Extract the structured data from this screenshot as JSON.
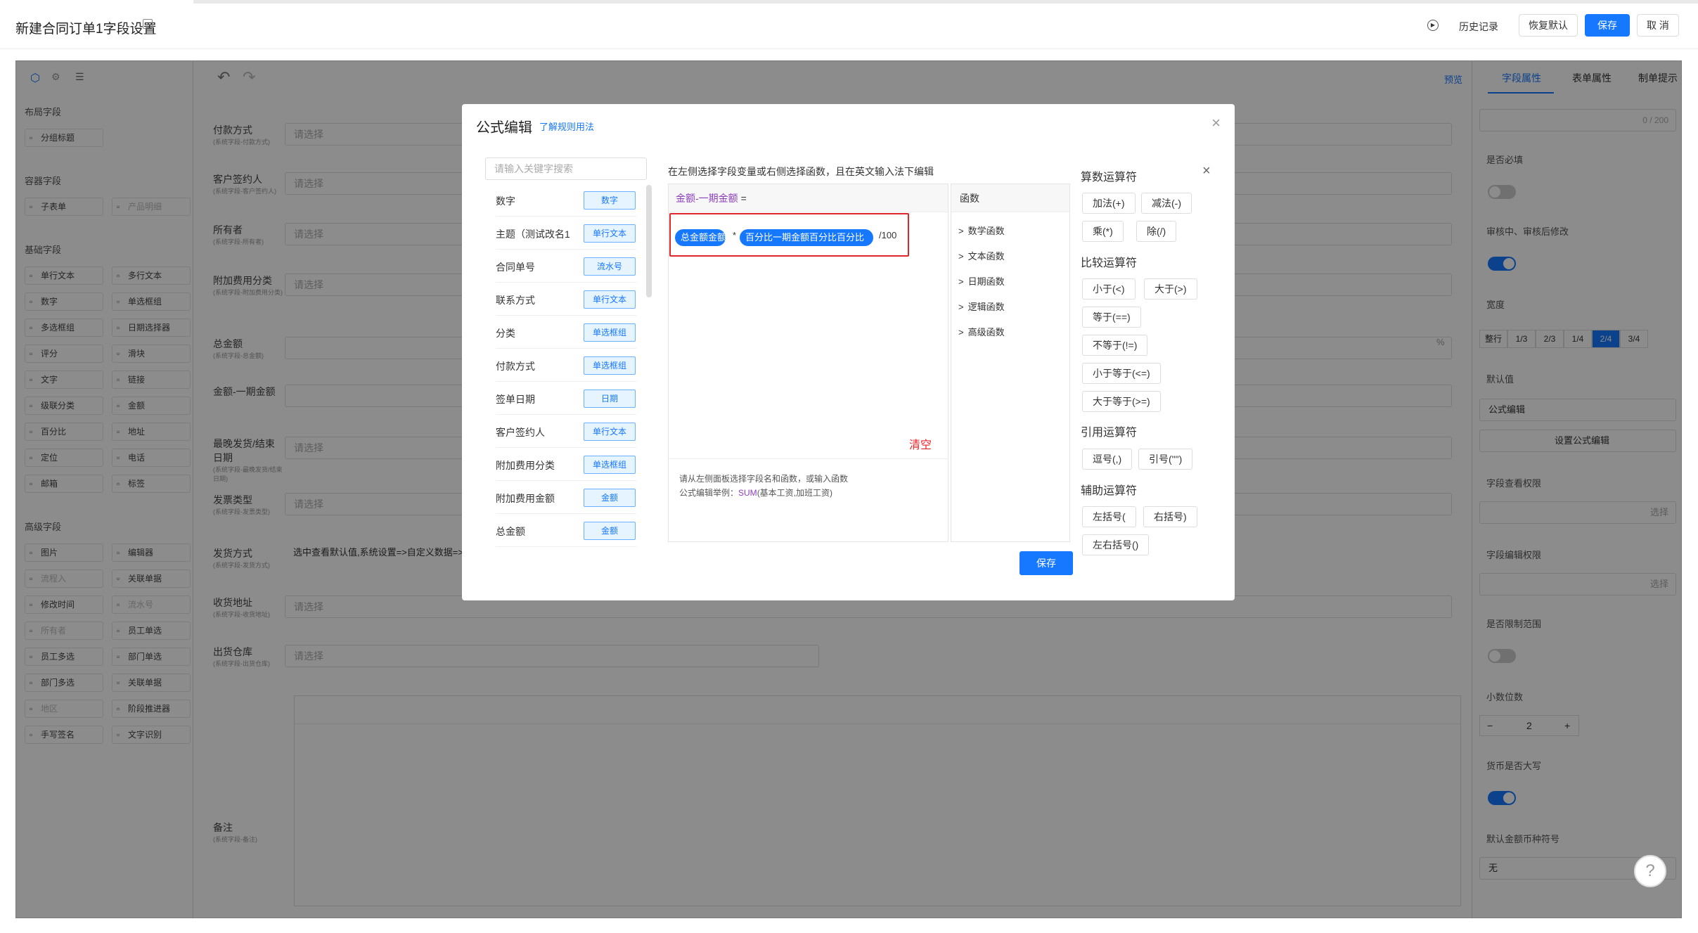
{
  "header": {
    "title": "新建合同订单1字段设置",
    "history": "历史记录",
    "restore": "恢复默认",
    "save": "保存",
    "cancel": "取 消"
  },
  "left_panel": {
    "sections": {
      "layout": "布局字段",
      "container": "容器字段",
      "basic": "基础字段",
      "advanced": "高级字段"
    },
    "layout_items": [
      "分组标题"
    ],
    "container_items": [
      "子表单",
      "产品明细"
    ],
    "basic_items": [
      "单行文本",
      "多行文本",
      "数字",
      "单选框组",
      "多选框组",
      "日期选择器",
      "评分",
      "滑块",
      "文字",
      "链接",
      "级联分类",
      "金额",
      "百分比",
      "地址",
      "定位",
      "电话",
      "邮箱",
      "标签"
    ],
    "advanced_items": [
      "图片",
      "编辑器",
      "流程入",
      "关联单据",
      "修改时间",
      "流水号",
      "所有者",
      "员工单选",
      "员工多选",
      "部门单选",
      "部门多选",
      "关联单据",
      "地区",
      "阶段推进器",
      "手写签名",
      "文字识别"
    ]
  },
  "form": {
    "placeholder": "请选择",
    "fields": [
      {
        "label": "付款方式",
        "sub": "(系统字段-付款方式)"
      },
      {
        "label": "客户签约人",
        "sub": "(系统字段-客户签约人)"
      },
      {
        "label": "所有者",
        "sub": "(系统字段-所有者)"
      },
      {
        "label": "附加费用分类",
        "sub": "(系统字段-附加费用分类)"
      },
      {
        "label": "总金额",
        "sub": "(系统字段-总金额)"
      },
      {
        "label": "金额-一期金额",
        "sub": ""
      },
      {
        "label": "最晚发货/结束日期",
        "sub": "(系统字段-最晚发货/结束日期)"
      },
      {
        "label": "发票类型",
        "sub": "(系统字段-发票类型)"
      },
      {
        "label": "发货方式",
        "sub": "(系统字段-发货方式)"
      },
      {
        "label": "收货地址",
        "sub": "(系统字段-收货地址)"
      },
      {
        "label": "出货仓库",
        "sub": "(系统字段-出货仓库)"
      },
      {
        "label": "备注",
        "sub": "(系统字段-备注)"
      }
    ],
    "shipping_text": "选中查看默认值,系统设置=>自定义数据=>",
    "percent": "%"
  },
  "right_panel": {
    "tabs": [
      "字段属性",
      "表单属性",
      "制单提示"
    ],
    "preview": "预览",
    "counter": "0 / 200",
    "required": "是否必填",
    "edit_after": "审核中、审核后修改",
    "width": "宽度",
    "width_opts": [
      "整行",
      "1/3",
      "2/3",
      "1/4",
      "2/4",
      "3/4"
    ],
    "default": "默认值",
    "default_select": "公式编辑",
    "set_formula": "设置公式编辑",
    "view_perm": "字段查看权限",
    "select": "选择",
    "edit_perm": "字段编辑权限",
    "limit_range": "是否限制范围",
    "decimals": "小数位数",
    "decimal_value": "2",
    "minus": "−",
    "plus": "+",
    "uppercase": "货币是否大写",
    "currency_symbol": "默认金额币种符号",
    "currency_value": "无"
  },
  "modal": {
    "title": "公式编辑",
    "link": "了解规则用法",
    "search_placeholder": "请输入关键字搜索",
    "hint": "在左侧选择字段变量或右侧选择函数，且在英文输入法下编辑",
    "target": "金额-一期金额",
    "equals": "=",
    "pill1": "总金额金额",
    "op1": "*",
    "pill2": "百分比一期金额百分比百分比",
    "op2": "/100",
    "clear": "清空",
    "desc1": "请从左侧面板选择字段名和函数，或输入函数",
    "desc2_prefix": "公式编辑举例：",
    "desc2_fn": "SUM",
    "desc2_suffix": "(基本工资,加班工资)",
    "save": "保存",
    "variables": [
      {
        "name": "数字",
        "type": "数字"
      },
      {
        "name": "主题（测试改名1",
        "type": "单行文本"
      },
      {
        "name": "合同单号",
        "type": "流水号"
      },
      {
        "name": "联系方式",
        "type": "单行文本"
      },
      {
        "name": "分类",
        "type": "单选框组"
      },
      {
        "name": "付款方式",
        "type": "单选框组"
      },
      {
        "name": "签单日期",
        "type": "日期"
      },
      {
        "name": "客户签约人",
        "type": "单行文本"
      },
      {
        "name": "附加费用分类",
        "type": "单选框组"
      },
      {
        "name": "附加费用金额",
        "type": "金额"
      },
      {
        "name": "总金额",
        "type": "金额"
      }
    ],
    "functions_title": "函数",
    "functions": [
      "数学函数",
      "文本函数",
      "日期函数",
      "逻辑函数",
      "高级函数"
    ],
    "op_sections": {
      "arith": "算数运算符",
      "compare": "比较运算符",
      "quote": "引用运算符",
      "aux": "辅助运算符"
    },
    "arith_ops": [
      "加法(+)",
      "减法(-)",
      "乘(*)",
      "除(/)"
    ],
    "compare_ops": [
      "小于(<)",
      "大于(>)",
      "等于(==)",
      "不等于(!=)",
      "小于等于(<=)",
      "大于等于(>=)"
    ],
    "quote_ops": [
      "逗号(,)",
      "引号(\"\")"
    ],
    "aux_ops": [
      "左括号(",
      "右括号)",
      "左右括号()"
    ]
  },
  "colors": {
    "primary": "#1677ff",
    "danger": "#e0252b",
    "formula_purple": "#8e3fbf"
  }
}
